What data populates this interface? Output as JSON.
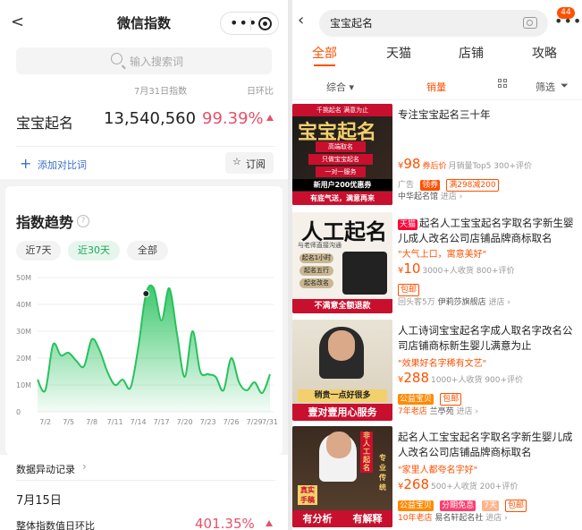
{
  "left": {
    "header": {
      "back": "<",
      "title": "微信指数",
      "more": "•••"
    },
    "search": {
      "placeholder": "输入搜索词"
    },
    "date_label": "7月31日指数",
    "dod_label": "日环比",
    "keyword": {
      "name": "宝宝起名",
      "value": "13,540,560",
      "pct": "99.39%"
    },
    "add_compare": "添加对比词",
    "subscribe": "订阅",
    "trend_title": "指数趋势",
    "ranges": [
      "近7天",
      "近30天",
      "全部"
    ],
    "active_range": "近30天",
    "abnormal_label": "数据异动记录",
    "abnormal_date": "7月15日",
    "abnormal_text": "整体指数值日环比",
    "abnormal_pct": "401.35%"
  },
  "chart_data": {
    "type": "area",
    "ylabels": [
      "0",
      "10M",
      "20M",
      "30M",
      "40M",
      "50M"
    ],
    "xlabels": [
      "7/2",
      "7/5",
      "7/8",
      "7/11",
      "7/14",
      "7/17",
      "7/20",
      "7/23",
      "7/26",
      "7/29",
      "7/31"
    ],
    "ylim": [
      0,
      50
    ],
    "x": [
      "7/1",
      "7/2",
      "7/3",
      "7/4",
      "7/5",
      "7/6",
      "7/7",
      "7/8",
      "7/9",
      "7/10",
      "7/11",
      "7/12",
      "7/13",
      "7/14",
      "7/15",
      "7/16",
      "7/17",
      "7/18",
      "7/19",
      "7/20",
      "7/21",
      "7/22",
      "7/23",
      "7/24",
      "7/25",
      "7/26",
      "7/27",
      "7/28",
      "7/29",
      "7/30",
      "7/31"
    ],
    "values": [
      12,
      8,
      25,
      21,
      22,
      19,
      17,
      27,
      23,
      15,
      10,
      12,
      9,
      24,
      44,
      46,
      34,
      46,
      29,
      13,
      30,
      15,
      14,
      13,
      8,
      20,
      11,
      8,
      11,
      7,
      14
    ],
    "grid": true,
    "color": "#27c25d"
  },
  "right": {
    "search_query": "宝宝起名",
    "badge": "44",
    "tabs": [
      "全部",
      "天猫",
      "店铺",
      "攻略"
    ],
    "active_tab": "全部",
    "sort": {
      "comprehensive": "综合",
      "sales": "销量",
      "filter": "筛选"
    },
    "items": [
      {
        "title": "专注宝宝起名三十年",
        "thumb_lines": [
          "千挑起名 满意为止",
          "宝宝起名",
          "高端取名",
          "只做宝宝起名",
          "一对一服务",
          "新用户200优惠券",
          "有底气送，满意再来"
        ],
        "price": "98",
        "price_note": "券后价",
        "meta": "月销量Top5 300+评价",
        "tags": [
          "广告",
          "领券",
          "满298减200"
        ],
        "shop": "中华起名馆",
        "shop_link": "进店"
      },
      {
        "title": "起名人工宝宝起名字取名字新生婴儿成人改名公司店铺品牌商标取名",
        "title_tag": "天猫",
        "thumb_lines": [
          "人工起名",
          "与老师直接沟通",
          "起名1小时",
          "起名五行",
          "起名改名",
          "不满意全额退款"
        ],
        "slogan": "\"大气上口，寓意美好\"",
        "price": "10",
        "meta": "3000+人收货 800+评价",
        "tags": [
          "包邮"
        ],
        "shop_prefix": "回头客5万",
        "shop": "伊莉莎旗舰店",
        "shop_link": "进店"
      },
      {
        "title": "人工诗词宝宝起名字成人取名字改名公司店铺商标新生婴儿满意为止",
        "thumb_lines": [
          "稍贵一点好很多",
          "壹对壹用心服务"
        ],
        "slogan": "\"效果好名字稀有文艺\"",
        "price": "288",
        "meta": "1000+人收货 900+评价",
        "tags": [
          "公益宝贝",
          "包邮"
        ],
        "shop_prefix": "7年老店",
        "shop": "兰亭苑",
        "shop_link": "进店"
      },
      {
        "title": "起名人工宝宝起名字取名字新生婴儿成人改名公司店铺品牌商标取名",
        "thumb_lines": [
          "非人工起名",
          "专业传统",
          "真实手稿",
          "有分析",
          "有解释"
        ],
        "slogan": "\"家里人都夸名字好\"",
        "price": "268",
        "meta": "500+人收货 200+评价",
        "tags": [
          "公益宝贝",
          "分期免息",
          "7天",
          "包邮"
        ],
        "shop_prefix": "10年老店",
        "shop": "易名轩起名社",
        "shop_link": "进店"
      }
    ]
  }
}
